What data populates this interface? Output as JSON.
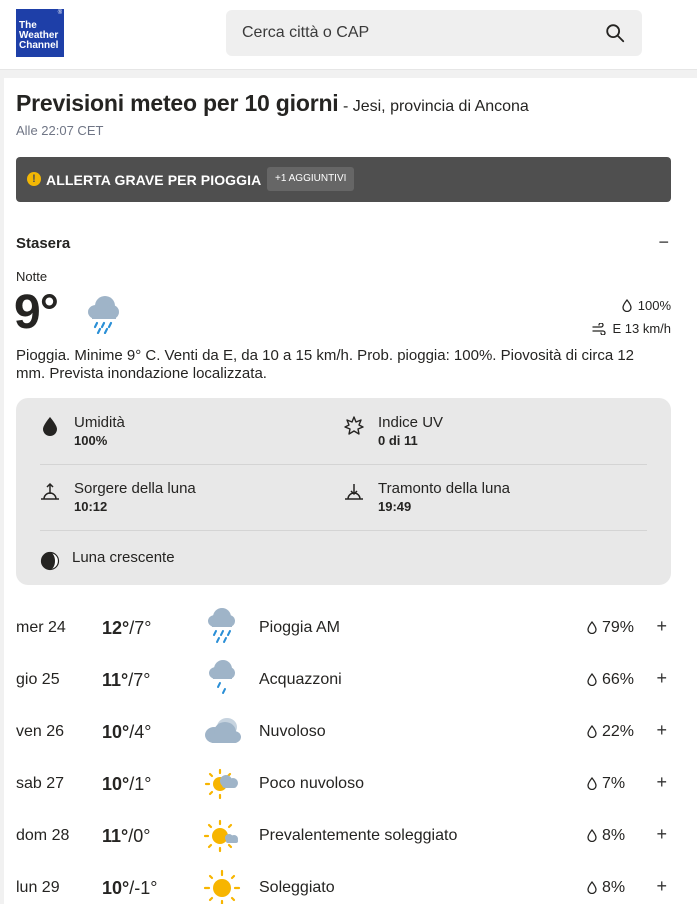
{
  "header": {
    "logo": [
      "The",
      "Weather",
      "Channel"
    ],
    "search_placeholder": "Cerca città o CAP"
  },
  "page": {
    "title": "Previsioni meteo per 10 giorni",
    "location": "- Jesi, provincia di Ancona",
    "updated": "Alle 22:07 CET"
  },
  "alert": {
    "text": "ALLERTA GRAVE PER PIOGGIA",
    "badge": "+1 AGGIUNTIVI"
  },
  "tonight": {
    "heading": "Stasera",
    "collapse": "−",
    "period": "Notte",
    "temp": "9°",
    "precip": "100%",
    "wind": "E 13 km/h",
    "description": "Pioggia. Minime 9° C. Venti da E, da 10 a 15 km/h. Prob. pioggia: 100%. Piovosità di circa 12 mm. Prevista inondazione localizzata.",
    "details": {
      "humidity_label": "Umidità",
      "humidity_value": "100%",
      "uv_label": "Indice UV",
      "uv_value": "0 di 11",
      "moonrise_label": "Sorgere della luna",
      "moonrise_value": "10:12",
      "moonset_label": "Tramonto della luna",
      "moonset_value": "19:49",
      "moon_phase": "Luna crescente"
    }
  },
  "days": [
    {
      "name": "mer 24",
      "hi": "12°",
      "lo": "/7°",
      "icon": "rain-icon",
      "cond": "Pioggia AM",
      "precip": "79%"
    },
    {
      "name": "gio 25",
      "hi": "11°",
      "lo": "/7°",
      "icon": "showers-icon",
      "cond": "Acquazzoni",
      "precip": "66%"
    },
    {
      "name": "ven 26",
      "hi": "10°",
      "lo": "/4°",
      "icon": "cloudy-icon",
      "cond": "Nuvoloso",
      "precip": "22%"
    },
    {
      "name": "sab 27",
      "hi": "10°",
      "lo": "/1°",
      "icon": "partly-cloudy-icon",
      "cond": "Poco nuvoloso",
      "precip": "7%"
    },
    {
      "name": "dom 28",
      "hi": "11°",
      "lo": "/0°",
      "icon": "mostly-sunny-icon",
      "cond": "Prevalentemente soleggiato",
      "precip": "8%"
    },
    {
      "name": "lun 29",
      "hi": "10°",
      "lo": "/-1°",
      "icon": "sunny-icon",
      "cond": "Soleggiato",
      "precip": "8%"
    }
  ],
  "colors": {
    "brand": "#1e3fa8",
    "alert_bg": "#4f4f4f",
    "alert_icon": "#f2b705",
    "rain_drop": "#2a8fd6",
    "cloud": "#9fb4c8",
    "sun": "#f7b500"
  }
}
